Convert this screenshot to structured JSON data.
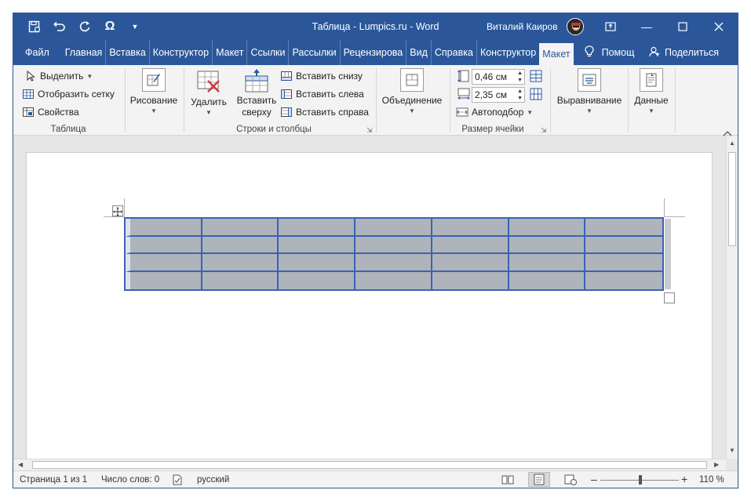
{
  "window": {
    "title": "Таблица - Lumpics.ru  -  Word",
    "user": "Виталий Каиров"
  },
  "qat": {
    "save_icon": "save-autosave-icon",
    "undo_icon": "undo-icon",
    "redo_icon": "redo-icon",
    "symbol": "Ω",
    "customize_icon": "customize-qat-icon"
  },
  "tabs": [
    "Файл",
    "Главная",
    "Вставка",
    "Конструктор",
    "Макет",
    "Ссылки",
    "Рассылки",
    "Рецензирова",
    "Вид",
    "Справка",
    "Конструктор",
    "Макет",
    "Помощ"
  ],
  "share": "Поделиться",
  "ribbon": {
    "table_group": {
      "select": "Выделить",
      "gridlines": "Отобразить сетку",
      "properties": "Свойства",
      "label": "Таблица"
    },
    "draw": {
      "label": "Рисование"
    },
    "rows_cols": {
      "delete": "Удалить",
      "insert_above_1": "Вставить",
      "insert_above_2": "сверху",
      "insert_below": "Вставить снизу",
      "insert_left": "Вставить слева",
      "insert_right": "Вставить справа",
      "label": "Строки и столбцы"
    },
    "merge": {
      "label": "Объединение"
    },
    "cell_size": {
      "height": "0,46 см",
      "width": "2,35 см",
      "autofit": "Автоподбор",
      "label": "Размер ячейки"
    },
    "alignment": {
      "label": "Выравнивание"
    },
    "data": {
      "label": "Данные"
    }
  },
  "table": {
    "rows": 4,
    "cols": 7,
    "selected": true,
    "cell_fill": "#aeb4ba",
    "border": "#3a62b8"
  },
  "status": {
    "page": "Страница 1 из 1",
    "words": "Число слов: 0",
    "language": "русский",
    "zoom": "110 %"
  }
}
